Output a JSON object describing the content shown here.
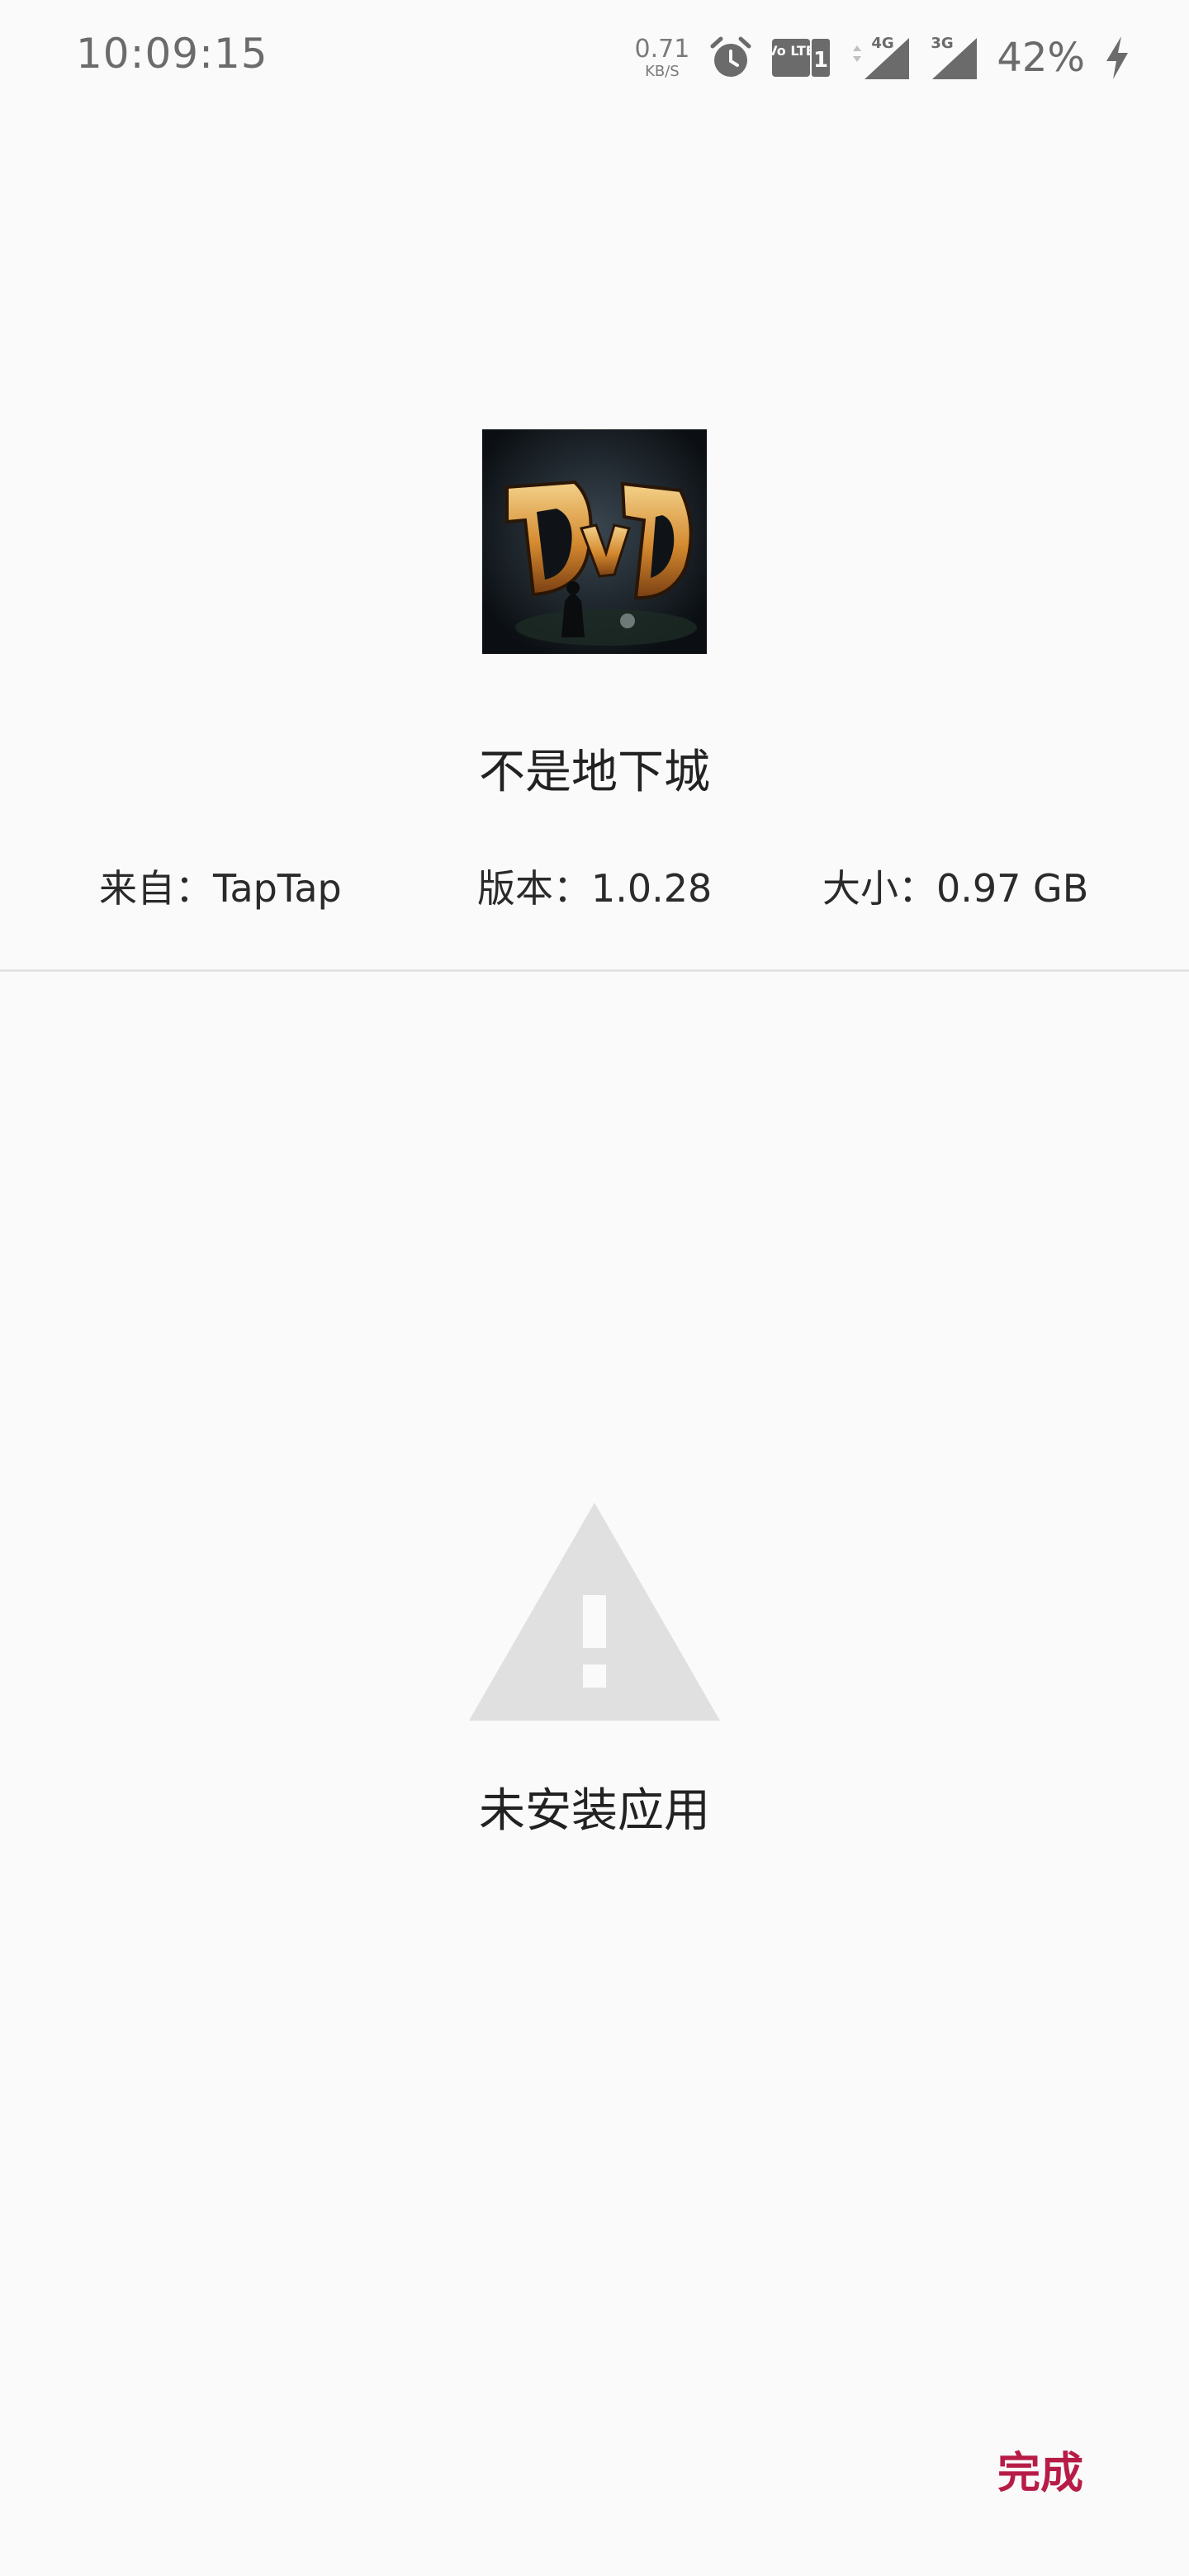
{
  "status_bar": {
    "time": "10:09:15",
    "net_speed_value": "0.71",
    "net_speed_unit": "KB/S",
    "lte_label": "Vo LTE",
    "lte_slot": "1",
    "signal_1_label": "4G",
    "signal_2_label": "3G",
    "battery_percent": "42%",
    "icons": [
      "alarm-icon",
      "volte-icon",
      "signal-4g-icon",
      "signal-3g-icon",
      "charging-icon"
    ]
  },
  "app": {
    "icon_name": "game-logo-icon",
    "name": "不是地下城",
    "source": "来自：TapTap",
    "version": "版本：1.0.28",
    "size": "大小：0.97 GB"
  },
  "result": {
    "icon_name": "warning-icon",
    "message": "未安装应用"
  },
  "actions": {
    "done_label": "完成"
  },
  "colors": {
    "background": "#fafafa",
    "accent": "#b71c47",
    "warning_icon": "#e0e0e0",
    "divider": "#e4e4e4"
  }
}
